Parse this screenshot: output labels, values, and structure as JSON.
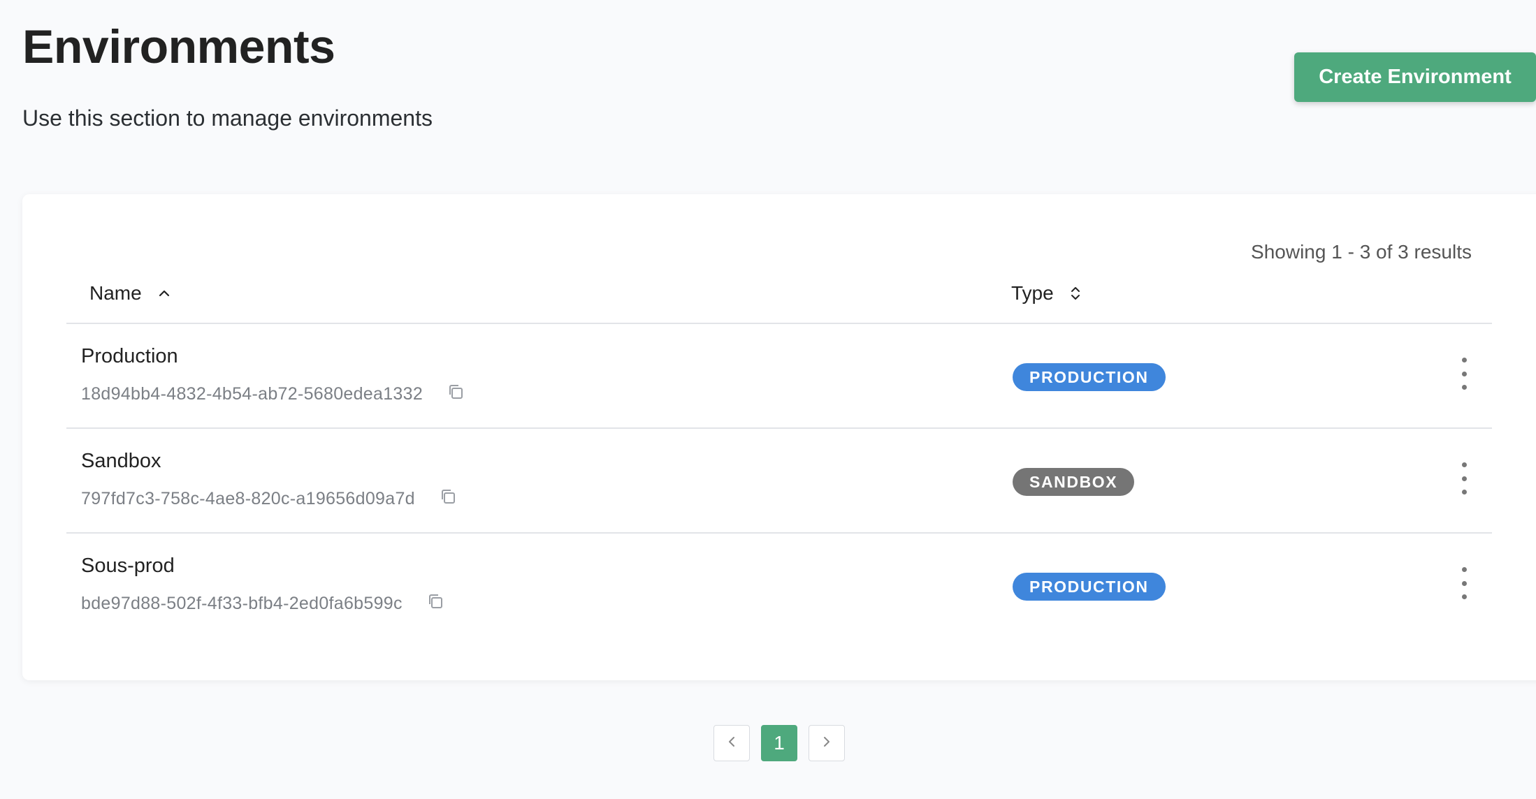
{
  "header": {
    "title": "Environments",
    "subtitle": "Use this section to manage environments",
    "create_label": "Create Environment"
  },
  "table": {
    "results_text": "Showing 1 - 3 of 3 results",
    "columns": [
      {
        "label": "Name",
        "sort": "ascending"
      },
      {
        "label": "Type",
        "sort": "unsorted"
      }
    ],
    "rows": [
      {
        "name": "Production",
        "id": "18d94bb4-4832-4b54-ab72-5680edea1332",
        "type": "PRODUCTION"
      },
      {
        "name": "Sandbox",
        "id": "797fd7c3-758c-4ae8-820c-a19656d09a7d",
        "type": "SANDBOX"
      },
      {
        "name": "Sous-prod",
        "id": "bde97d88-502f-4f33-bfb4-2ed0fa6b599c",
        "type": "PRODUCTION"
      }
    ]
  },
  "pagination": {
    "current_page": "1",
    "prev_icon": "chevron-left-icon",
    "next_icon": "chevron-right-icon"
  },
  "colors": {
    "accent": "#4ea97d",
    "production_badge": "#3f86dc",
    "sandbox_badge": "#757575"
  }
}
